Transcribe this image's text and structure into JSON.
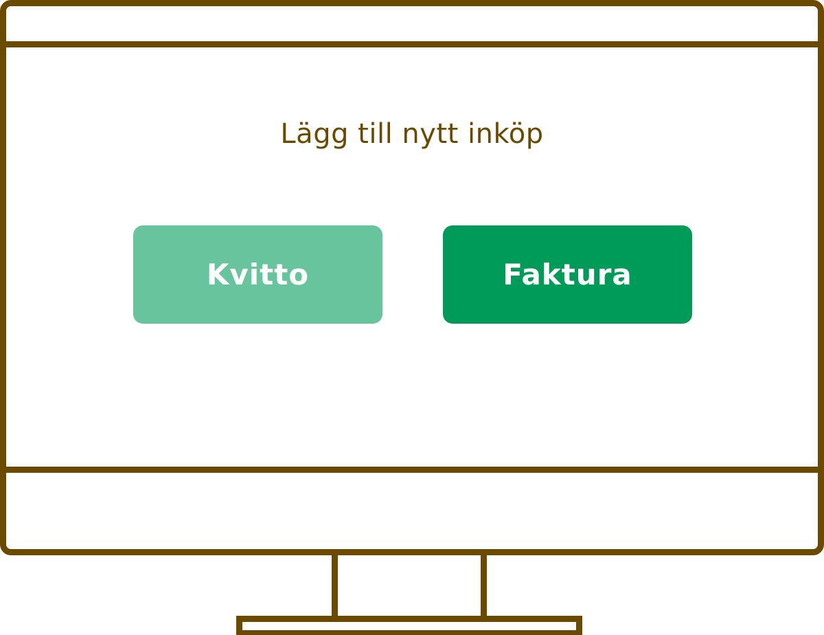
{
  "screen": {
    "title": "Lägg till nytt inköp"
  },
  "buttons": {
    "receipt_label": "Kvitto",
    "invoice_label": "Faktura"
  },
  "colors": {
    "frame": "#6b4a00",
    "title_text": "#6b4a00",
    "receipt_button": "#68c49c",
    "invoice_button": "#009b58",
    "button_text": "#ffffff",
    "background": "#ffffff"
  }
}
